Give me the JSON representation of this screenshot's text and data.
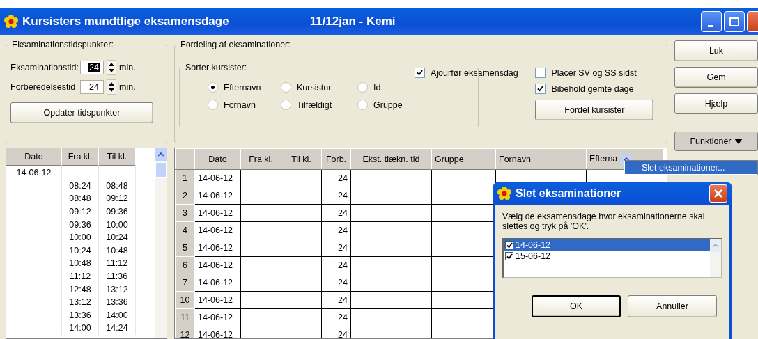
{
  "window": {
    "title": "Kursisters mundtlige eksamensdage",
    "subtitle": "11/12jan - Kemi"
  },
  "times_group": {
    "title": "Eksaminationstidspunkter:",
    "fields": [
      {
        "label": "Eksaminationstid:",
        "value": "24",
        "unit": "min.",
        "selected": true
      },
      {
        "label": "Forberedelsestid",
        "value": "24",
        "unit": "min.",
        "selected": false
      }
    ],
    "button": "Opdater tidspunkter"
  },
  "distribution_group": {
    "title": "Fordeling af eksaminationer:",
    "sort": {
      "title": "Sorter kursister:",
      "options": [
        {
          "label": "Efternavn",
          "selected": true
        },
        {
          "label": "Kursistnr.",
          "selected": false
        },
        {
          "label": "Id",
          "selected": false
        },
        {
          "label": "Fornavn",
          "selected": false
        },
        {
          "label": "Tilfældigt",
          "selected": false
        },
        {
          "label": "Gruppe",
          "selected": false
        }
      ]
    },
    "checkboxes": [
      {
        "label": "Ajourfør eksamensdag",
        "checked": true
      },
      {
        "label": "Placer SV og SS sidst",
        "checked": false
      },
      {
        "label": "Bibehold gemte dage",
        "checked": true
      }
    ],
    "button": "Fordel kursister"
  },
  "side_buttons": [
    "Luk",
    "Gem",
    "Hjælp"
  ],
  "functions_button": "Funktioner",
  "functions_menu": [
    {
      "label": "Slet eksaminationer...",
      "selected": true
    }
  ],
  "schedule": {
    "columns": [
      "Dato",
      "Fra kl.",
      "Til kl."
    ],
    "rows": [
      {
        "dato": "14-06-12"
      },
      {
        "fra": "08:24",
        "til": "08:48"
      },
      {
        "fra": "08:48",
        "til": "09:12"
      },
      {
        "fra": "09:12",
        "til": "09:36"
      },
      {
        "fra": "09:36",
        "til": "10:00"
      },
      {
        "fra": "10:00",
        "til": "10:24"
      },
      {
        "fra": "10:24",
        "til": "10:48"
      },
      {
        "fra": "10:48",
        "til": "11:12"
      },
      {
        "fra": "11:12",
        "til": "11:36"
      },
      {
        "fra": "12:48",
        "til": "13:12"
      },
      {
        "fra": "13:12",
        "til": "13:36"
      },
      {
        "fra": "13:36",
        "til": "14:00"
      },
      {
        "fra": "14:00",
        "til": "14:24"
      }
    ]
  },
  "table": {
    "columns": [
      "Dato",
      "Fra kl.",
      "Til kl.",
      "Forb.",
      "Ekst. tiækn. tid",
      "Gruppe",
      "Fornavn",
      "Efterna"
    ],
    "rows": [
      {
        "number": "1",
        "dato": "14-06-12",
        "forb": "24"
      },
      {
        "number": "2",
        "dato": "14-06-12",
        "forb": "24"
      },
      {
        "number": "3",
        "dato": "14-06-12",
        "forb": "24"
      },
      {
        "number": "4",
        "dato": "14-06-12",
        "forb": "24"
      },
      {
        "number": "5",
        "dato": "14-06-12",
        "forb": "24"
      },
      {
        "number": "6",
        "dato": "14-06-12",
        "forb": "24"
      },
      {
        "number": "7",
        "dato": "14-06-12",
        "forb": "24"
      },
      {
        "number": "10",
        "dato": "14-06-12",
        "forb": "24"
      },
      {
        "number": "11",
        "dato": "14-06-12",
        "forb": "24"
      },
      {
        "number": "12",
        "dato": "14-06-12",
        "forb": "24"
      }
    ]
  },
  "dialog": {
    "title": "Slet eksaminationer",
    "message": "Vælg de eksamensdage hvor eksaminationerne skal slettes og tryk på 'OK'.",
    "items": [
      {
        "label": "14-06-12",
        "checked": true,
        "selected": true
      },
      {
        "label": "15-06-12",
        "checked": true,
        "selected": false
      }
    ],
    "buttons": [
      "OK",
      "Annuller"
    ]
  }
}
